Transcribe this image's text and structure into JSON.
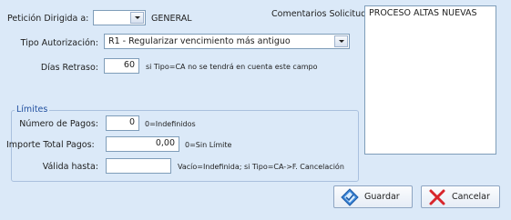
{
  "request": {
    "directed_to_label": "Petición Dirigida a:",
    "directed_to_value": "",
    "directed_to_text": "GENERAL",
    "comments_label": "Comentarios Solicitud:",
    "comments_value": "PROCESO ALTAS NUEVAS"
  },
  "authorization": {
    "label": "Tipo Autorización:",
    "value": "R1 - Regularizar vencimiento más antiguo"
  },
  "delay": {
    "label": "Días Retraso:",
    "value": "60",
    "hint": "si Tipo=CA no se tendrá en cuenta este campo"
  },
  "limits": {
    "legend": "Límites",
    "payments_label": "Número de Pagos:",
    "payments_value": "0",
    "payments_hint": "0=Indefinidos",
    "total_label": "Importe Total Pagos:",
    "total_value": "0,00",
    "total_hint": "0=Sin Límite",
    "valid_until_label": "Válida hasta:",
    "valid_until_value": "",
    "valid_until_hint": "Vacío=Indefinida; si Tipo=CA->F. Cancelación"
  },
  "buttons": {
    "save_label": "Guardar",
    "cancel_label": "Cancelar"
  },
  "colors": {
    "panel": "#dbe9f8",
    "legend_text": "#1f4e9e",
    "cancel_x": "#d8252b",
    "save_icon": "#3a86d8"
  }
}
